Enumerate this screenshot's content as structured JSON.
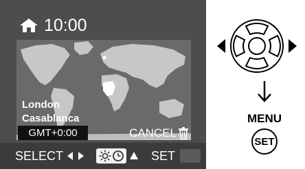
{
  "screen": {
    "time": "10:00",
    "home_icon": "home-icon",
    "city_line_1": "London",
    "city_line_2": "Casablanca",
    "gmt_offset": "GMT+0:00",
    "cancel_label": "CANCEL",
    "cancel_icon": "trash-icon"
  },
  "bottom_bar": {
    "select_label": "SELECT",
    "mode_icon": "sun-clock-icon",
    "set_label": "SET"
  },
  "controls": {
    "menu_label": "MENU",
    "set_button_label": "SET"
  },
  "colors": {
    "screen_bg": "#4d4d4d",
    "map_bg": "#6a6a6a",
    "land": "#c7c7c7",
    "highlight": "#ffffff"
  }
}
